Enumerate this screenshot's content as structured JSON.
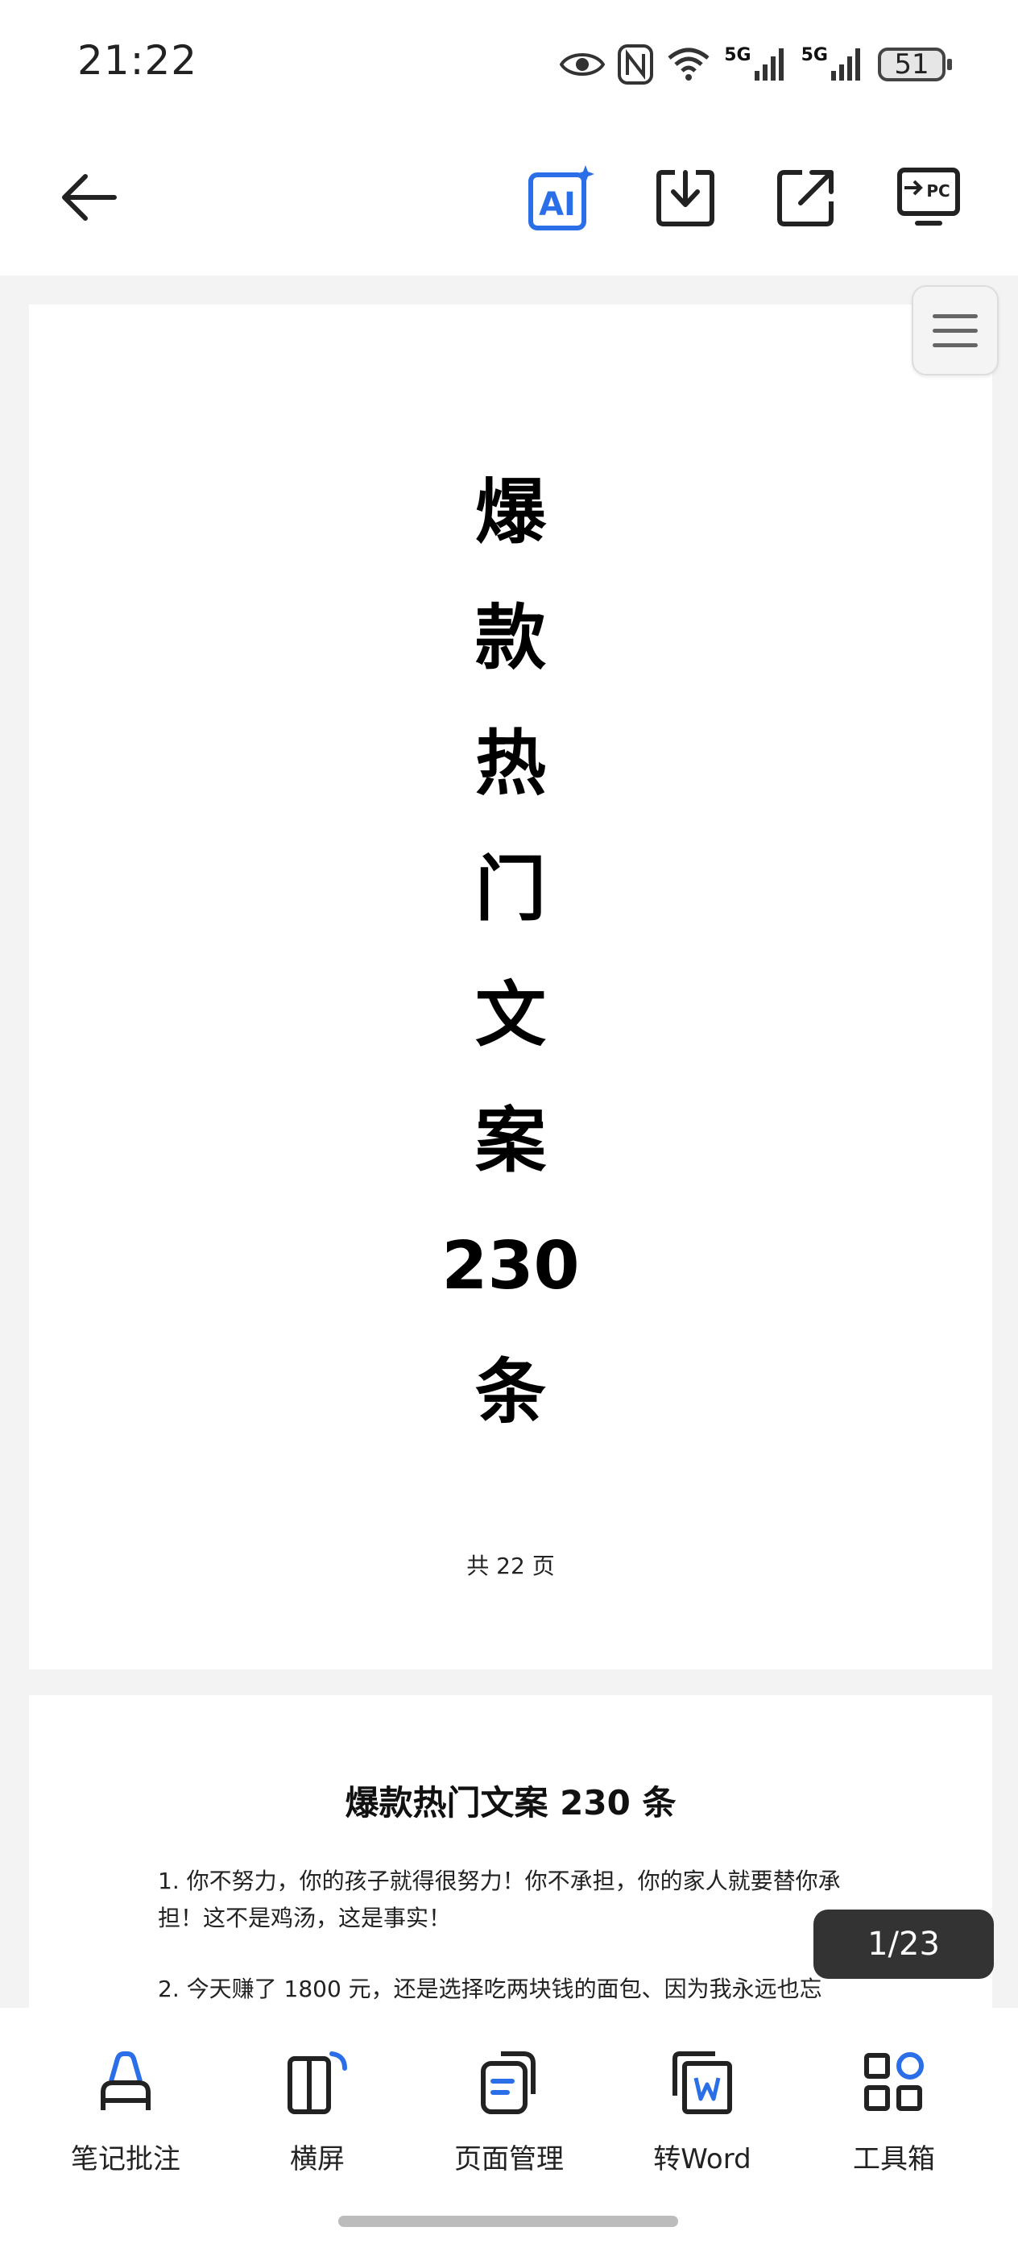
{
  "status": {
    "time": "21:22",
    "net1": "5G",
    "net2": "5G",
    "battery": "51"
  },
  "toolbar": {
    "back": "back",
    "ai_label": "AI",
    "download": "download",
    "share": "share",
    "pc_label": "PC"
  },
  "document": {
    "page1": {
      "title_chars": [
        "爆",
        "款",
        "热",
        "门",
        "文",
        "案",
        "230",
        "条"
      ],
      "total_pages_note": "共 22 页"
    },
    "page2": {
      "title": "爆款热门文案 230 条",
      "item1": "1. 你不努力，你的孩子就得很努力！你不承担，你的家人就要替你承担！这不是鸡汤，这是事实！",
      "item2": "2. 今天赚了 1800 元，还是选择吃两块钱的面包、因为我永远也忘"
    }
  },
  "page_indicator": "1/23",
  "bottom_bar": {
    "items": [
      {
        "label": "笔记批注",
        "icon": "annotate-icon"
      },
      {
        "label": "横屏",
        "icon": "rotate-icon"
      },
      {
        "label": "页面管理",
        "icon": "page-manage-icon"
      },
      {
        "label": "转Word",
        "icon": "to-word-icon"
      },
      {
        "label": "工具箱",
        "icon": "toolbox-icon"
      }
    ]
  },
  "colors": {
    "accent": "#2b6fe8",
    "icon_dark": "#222222"
  }
}
